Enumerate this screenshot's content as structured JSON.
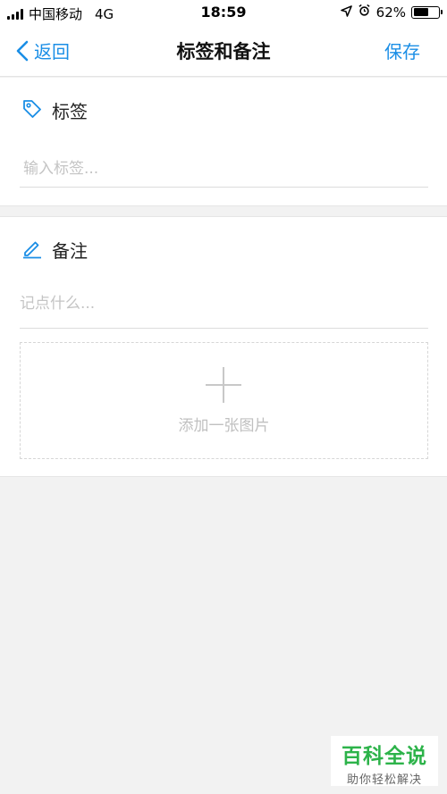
{
  "status_bar": {
    "carrier": "中国移动",
    "network": "4G",
    "time": "18:59",
    "battery_percent": "62%",
    "battery_level": 0.62,
    "icons": [
      "signal-icon",
      "location-arrow-icon",
      "alarm-clock-icon",
      "battery-icon"
    ]
  },
  "nav": {
    "back_label": "返回",
    "title": "标签和备注",
    "save_label": "保存",
    "accent_color": "#1a8ee6"
  },
  "tags": {
    "label": "标签",
    "icon": "tag-icon",
    "input_value": "",
    "placeholder": "输入标签..."
  },
  "notes": {
    "label": "备注",
    "icon": "pencil-icon",
    "input_value": "",
    "placeholder": "记点什么...",
    "add_image_label": "添加一张图片"
  },
  "watermark": {
    "main": "百科全说",
    "sub": "助你轻松解决"
  }
}
